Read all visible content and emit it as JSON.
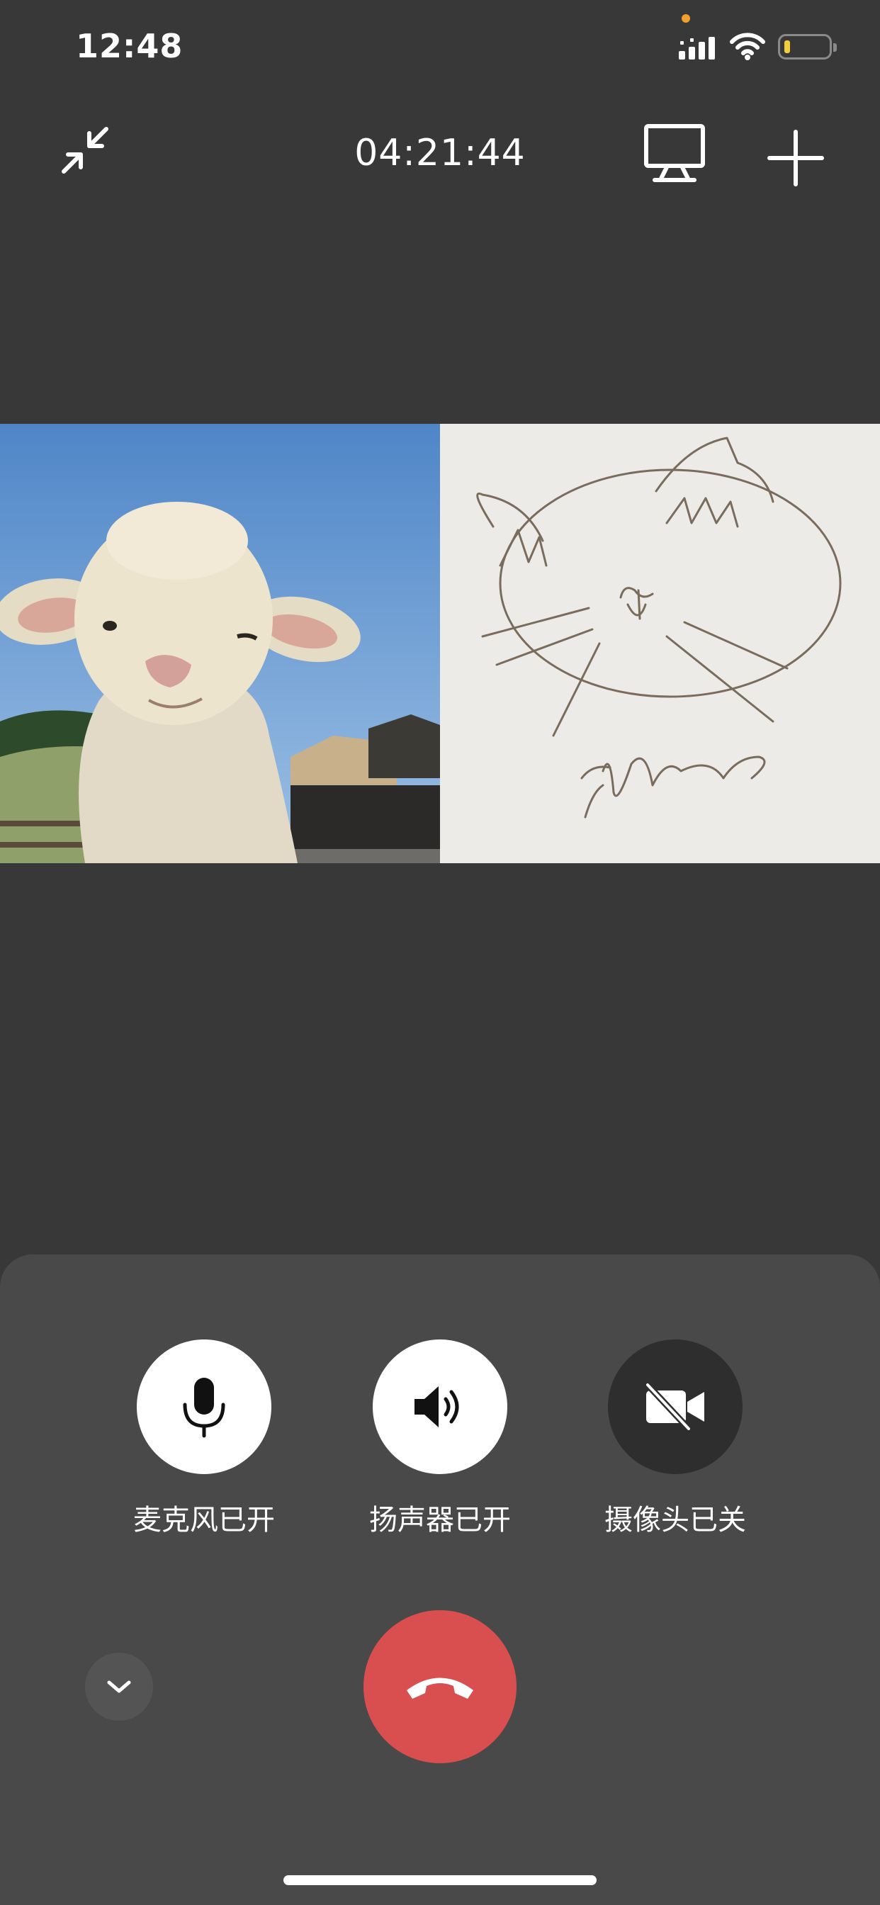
{
  "status_bar": {
    "time": "12:48",
    "icons": [
      "recording-dot-icon",
      "signal-icon",
      "wifi-icon",
      "battery-icon"
    ],
    "recording_dot_color": "#f0a030",
    "battery_color": "#f2cf3a"
  },
  "top_bar": {
    "minimize_icon": "minimize-arrows-icon",
    "call_duration": "04:21:44",
    "screen_share_icon": "screen-share-icon",
    "add_icon": "plus-icon"
  },
  "video_tiles": [
    {
      "name": "remote-video-lamb",
      "depicts": "lamb photo"
    },
    {
      "name": "remote-video-drawing",
      "depicts": "cat sketch"
    }
  ],
  "controls": {
    "mic": {
      "label": "麦克风已开",
      "icon": "microphone-icon",
      "state": "on"
    },
    "speaker": {
      "label": "扬声器已开",
      "icon": "speaker-icon",
      "state": "on"
    },
    "camera": {
      "label": "摄像头已关",
      "icon": "camera-off-icon",
      "state": "off"
    }
  },
  "bottom": {
    "collapse_icon": "chevron-down-icon",
    "hangup_icon": "hang-up-phone-icon",
    "hangup_color": "#d94f4f"
  },
  "colors": {
    "background": "#383838",
    "sheet": "#494949"
  }
}
